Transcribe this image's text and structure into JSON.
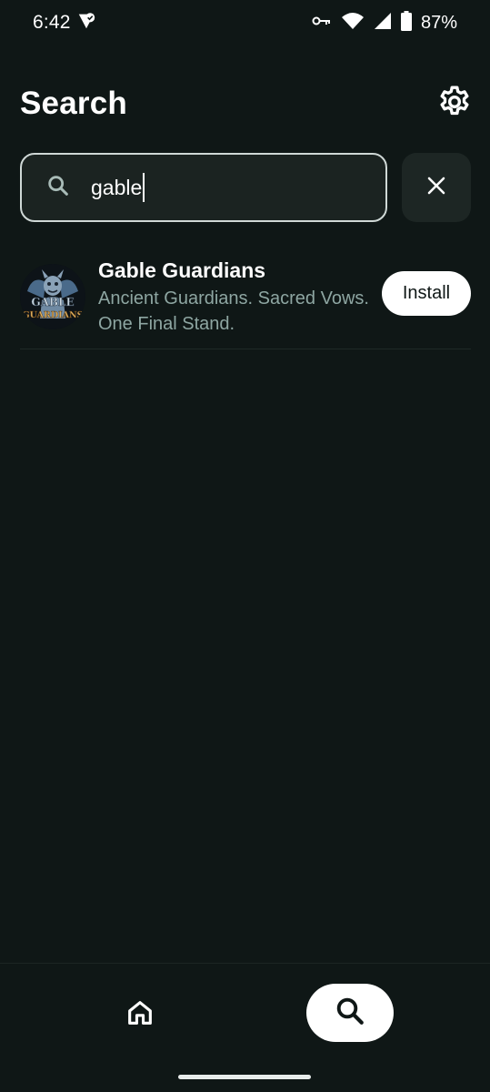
{
  "status_bar": {
    "time": "6:42",
    "battery_percent": "87%",
    "icons": [
      "verified-shield-icon",
      "vpn-key-icon",
      "wifi-icon",
      "cell-signal-icon",
      "battery-icon"
    ]
  },
  "header": {
    "title": "Search",
    "settings_icon": "gear-icon"
  },
  "search": {
    "value": "gable",
    "icon": "search-icon",
    "clear_icon": "close-icon"
  },
  "results": [
    {
      "name": "Gable Guardians",
      "description": "Ancient Guardians. Sacred Vows. One Final Stand.",
      "icon_text_line1": "GABLE",
      "icon_text_line2": "GUARDIANS",
      "action_label": "Install"
    }
  ],
  "bottom_nav": {
    "items": [
      {
        "icon": "home-icon",
        "active": false
      },
      {
        "icon": "search-icon",
        "active": true
      }
    ]
  },
  "colors": {
    "background": "#0f1716",
    "search_border": "#cfd8d6",
    "description_text": "#8ea6a2",
    "button_bg": "#ffffff"
  }
}
